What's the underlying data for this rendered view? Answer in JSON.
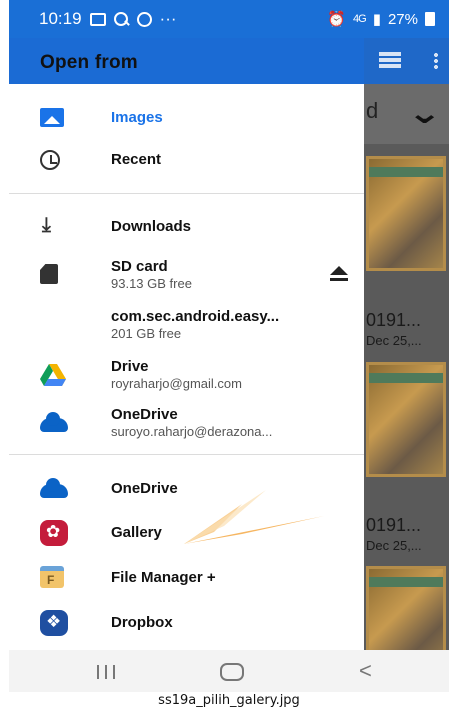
{
  "status_bar": {
    "time": "10:19",
    "more": "···",
    "network": "4G",
    "battery": "27%"
  },
  "drawer": {
    "title": "Open from",
    "items": [
      {
        "label": "Images",
        "icon": "image-icon",
        "color": "#1a73e8"
      },
      {
        "label": "Recent",
        "icon": "clock-icon"
      },
      {
        "label": "Downloads",
        "icon": "download-icon"
      },
      {
        "label": "SD card",
        "sub": "93.13 GB free",
        "icon": "sd-card-icon"
      },
      {
        "label": "com.sec.android.easy...",
        "sub": "201 GB free"
      },
      {
        "label": "Drive",
        "sub": "royraharjo@gmail.com",
        "icon": "google-drive-icon"
      },
      {
        "label": "OneDrive",
        "sub": "suroyo.raharjo@derazona...",
        "icon": "onedrive-icon"
      },
      {
        "label": "OneDrive",
        "icon": "onedrive-icon"
      },
      {
        "label": "Gallery",
        "icon": "gallery-icon",
        "color": "#c41c3b"
      },
      {
        "label": "File Manager +",
        "icon": "file-manager-icon"
      },
      {
        "label": "Dropbox",
        "icon": "dropbox-icon",
        "color": "#1f4fa1"
      }
    ]
  },
  "background_app": {
    "files": [
      {
        "name": "0191...",
        "date": "Dec 25,..."
      },
      {
        "name": "0191...",
        "date": "Dec 25,..."
      }
    ]
  },
  "caption": "ss19a_pilih_galery.jpg",
  "colors": {
    "accent": "#1b6bd4",
    "gallery": "#c41c3b",
    "annotation_arrow": "#f4a947"
  }
}
